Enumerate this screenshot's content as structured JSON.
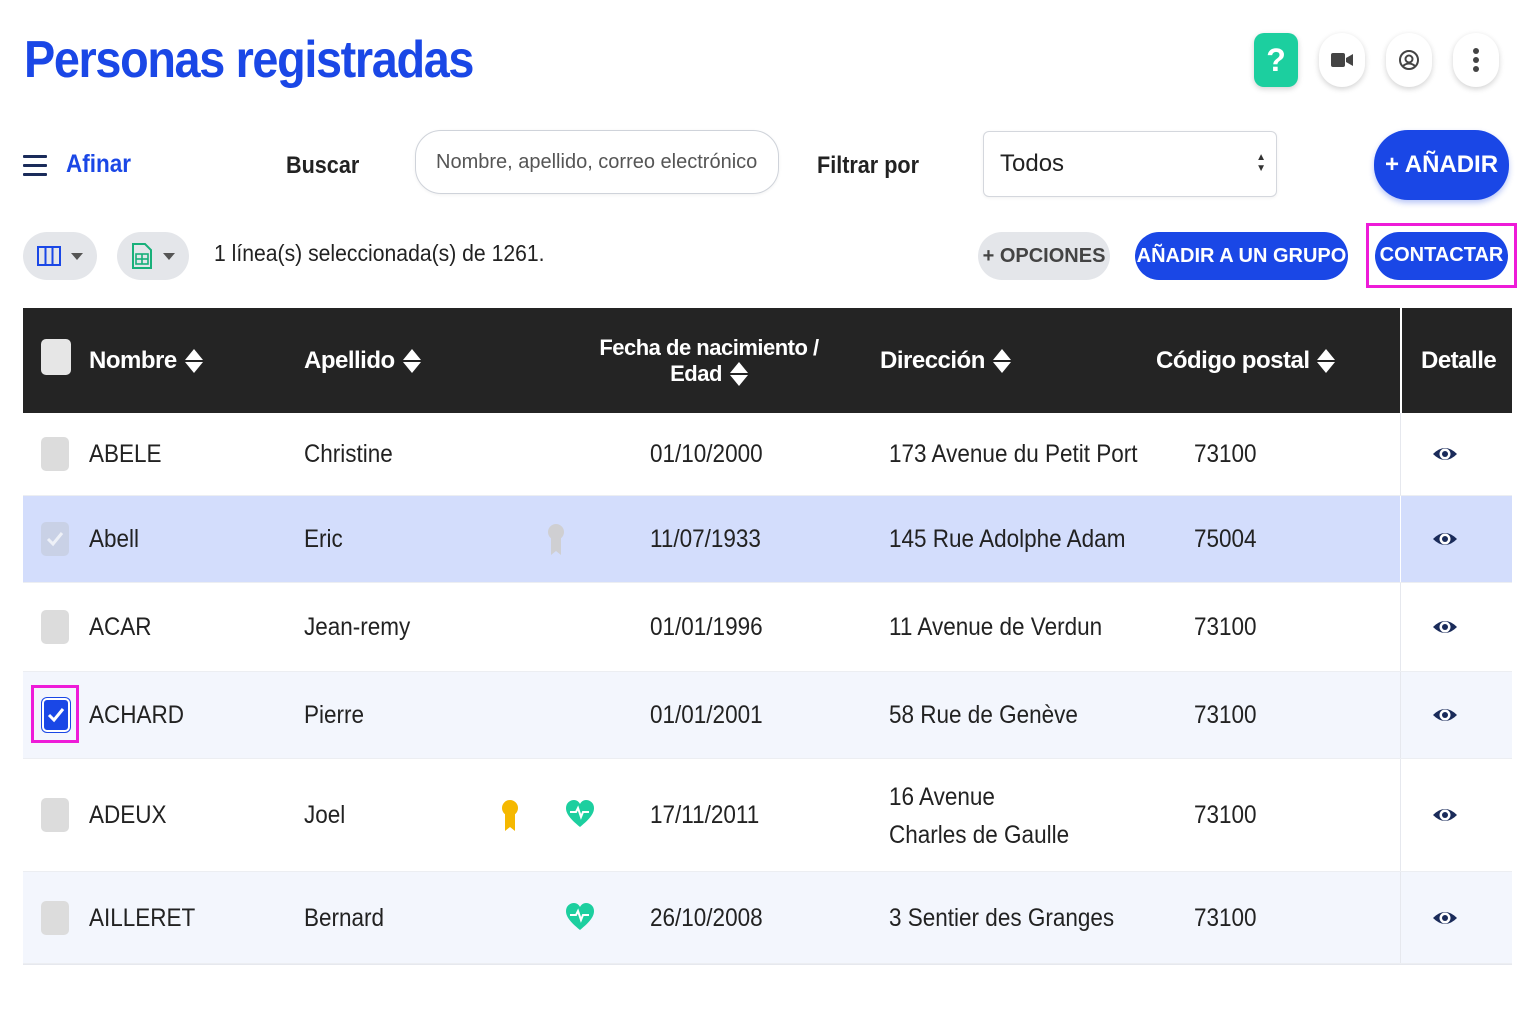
{
  "header": {
    "title": "Personas registradas"
  },
  "top_icons": [
    {
      "name": "help-icon",
      "glyph": "?"
    },
    {
      "name": "video-camera-icon"
    },
    {
      "name": "support-icon"
    },
    {
      "name": "more-vertical-icon"
    }
  ],
  "toolbar": {
    "refine_label": "Afinar",
    "search_label": "Buscar",
    "search_placeholder": "Nombre, apellido, correo electrónico, ...",
    "filter_label": "Filtrar por",
    "filter_value": "Todos",
    "add_label": "+ AÑADIR"
  },
  "subbar": {
    "selection_text": "1 línea(s) seleccionada(s) de 1261.",
    "options_label": "+ OPCIONES",
    "add_group_label": "AÑADIR A UN GRUPO",
    "contact_label": "CONTACTAR"
  },
  "table": {
    "headers": {
      "first_name": "Nombre",
      "last_name": "Apellido",
      "birth_line1": "Fecha de nacimiento /",
      "birth_line2": "Edad",
      "address": "Dirección",
      "postal": "Código postal",
      "detail": "Detalle"
    },
    "rows": [
      {
        "nombre": "ABELE",
        "apellido": "Christine",
        "fecha": "01/10/2000",
        "direccion": "173 Avenue du Petit Port",
        "cp": "73100",
        "state": "unchecked",
        "badges": []
      },
      {
        "nombre": "Abell",
        "apellido": "Eric",
        "fecha": "11/07/1933",
        "direccion": "145 Rue Adolphe Adam",
        "cp": "75004",
        "state": "disabled",
        "badges": [
          "grey-award-icon"
        ]
      },
      {
        "nombre": "ACAR",
        "apellido": "Jean-remy",
        "fecha": "01/01/1996",
        "direccion": "11 Avenue de Verdun",
        "cp": "73100",
        "state": "unchecked",
        "badges": []
      },
      {
        "nombre": "ACHARD",
        "apellido": "Pierre",
        "fecha": "01/01/2001",
        "direccion": "58 Rue de Genève",
        "cp": "73100",
        "state": "checked",
        "badges": []
      },
      {
        "nombre": "ADEUX",
        "apellido": "Joel",
        "fecha": "17/11/2011",
        "direccion": "16 Avenue Charles de Gaulle",
        "cp": "73100",
        "state": "unchecked",
        "badges": [
          "gold-award-icon",
          "heart-pulse-icon"
        ]
      },
      {
        "nombre": "AILLERET",
        "apellido": "Bernard",
        "fecha": "26/10/2008",
        "direccion": "3 Sentier des Granges",
        "cp": "73100",
        "state": "unchecked",
        "badges": [
          "heart-pulse-icon"
        ]
      }
    ]
  },
  "colors": {
    "primary": "#1a47e6",
    "highlight": "#ee1bd8",
    "header_bg": "#242424",
    "selected_row": "#d3ddfc",
    "help": "#1ccf9f",
    "gold": "#f5b800",
    "teal": "#1ccf9f"
  }
}
